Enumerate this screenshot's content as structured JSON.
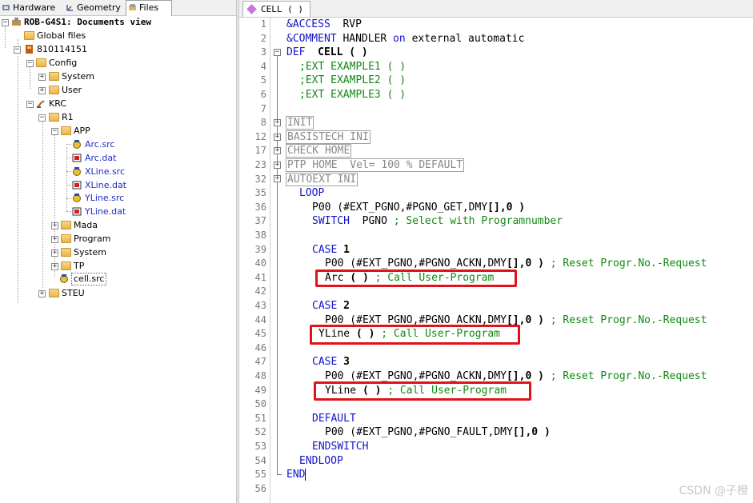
{
  "left_tabs": [
    {
      "label": "Hardware",
      "icon": "hardware-icon"
    },
    {
      "label": "Geometry",
      "icon": "geometry-icon"
    },
    {
      "label": "Files",
      "icon": "files-icon",
      "active": true
    }
  ],
  "tree": {
    "root": "ROB-G4S1: Documents view",
    "global_files": "Global files",
    "controller": "810114151",
    "config": "Config",
    "config_system": "System",
    "config_user": "User",
    "krc": "KRC",
    "r1": "R1",
    "app": "APP",
    "app_files": [
      "Arc.src",
      "Arc.dat",
      "XLine.src",
      "XLine.dat",
      "YLine.src",
      "YLine.dat"
    ],
    "mada": "Mada",
    "program": "Program",
    "system": "System",
    "tp": "TP",
    "selected_file": "cell.src",
    "steu": "STEU"
  },
  "editor": {
    "tab_label": "CELL ( )",
    "line_numbers": [
      "1",
      "2",
      "3",
      "4",
      "5",
      "6",
      "7",
      "8",
      "12",
      "17",
      "23",
      "32",
      "35",
      "36",
      "37",
      "38",
      "39",
      "40",
      "41",
      "42",
      "43",
      "44",
      "45",
      "46",
      "47",
      "48",
      "49",
      "50",
      "51",
      "52",
      "53",
      "54",
      "55",
      "56"
    ],
    "code": {
      "l1_kw": "&ACCESS",
      "l1_val": "RVP",
      "l2_kw": "&COMMENT",
      "l2_a": "HANDLER",
      "l2_on": "on",
      "l2_b": "external automatic",
      "l3_def": "DEF",
      "l3_name": "CELL",
      "l3_paren": "( )",
      "l4": ";EXT EXAMPLE1 ( )",
      "l5": ";EXT EXAMPLE2 ( )",
      "l6": ";EXT EXAMPLE3 ( )",
      "f8": "INIT",
      "f12": "BASISTECH INI",
      "f17": "CHECK HOME",
      "f23": "PTP HOME  Vel= 100 % DEFAULT",
      "f32": "AUTOEXT INI",
      "loop": "LOOP",
      "p00_get_a": "P00 (#EXT_PGNO,#PGNO_GET,DMY",
      "p00_get_b": "[]",
      "p00_get_c": ",0 )",
      "switch_kw": "SWITCH",
      "switch_var": "PGNO",
      "switch_cmt": "; Select with Programnumber",
      "case_kw": "CASE",
      "case1_num": "1",
      "case2_num": "2",
      "case3_num": "3",
      "ackn_a": "P00 (#EXT_PGNO,#PGNO_ACKN,DMY",
      "ackn_b": "[]",
      "ackn_c": ",0 )",
      "ackn_cmt": "; Reset Progr.No.-Request",
      "arc_call": "Arc",
      "yline_call": "YLine",
      "call_paren": "( )",
      "call_cmt": "; Call User-Program",
      "default_kw": "DEFAULT",
      "fault_a": "P00 (#EXT_PGNO,#PGNO_FAULT,DMY",
      "fault_b": "[]",
      "fault_c": ",0 )",
      "endswitch": "ENDSWITCH",
      "endloop": "ENDLOOP",
      "end": "END"
    }
  },
  "watermark": "CSDN @子橙",
  "colors": {
    "keyword": "#1515c8",
    "comment": "#118a11",
    "highlight_box": "#e0131a"
  }
}
